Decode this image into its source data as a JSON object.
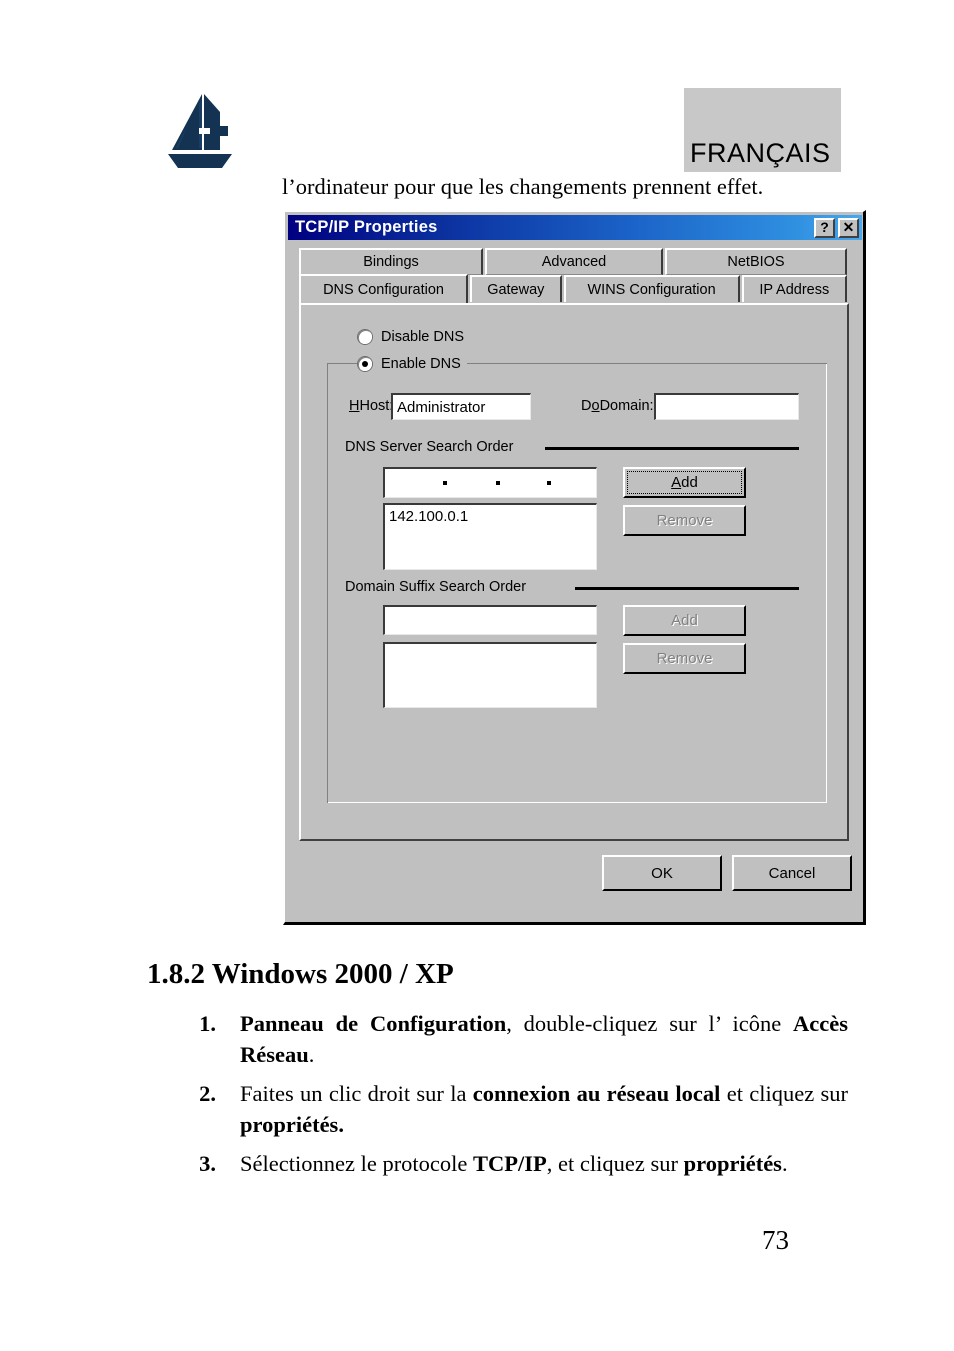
{
  "header": {
    "logo_alt": "Atlantis sailboat A logo",
    "language_label": "FRANÇAIS"
  },
  "intro_line": "l’ordinateur pour que les changements prennent effet.",
  "dialog": {
    "title": "TCP/IP Properties",
    "titlebar_buttons": [
      {
        "name": "help-button",
        "glyph": "?"
      },
      {
        "name": "close-button",
        "glyph": "✕"
      }
    ],
    "tabs_row1": [
      {
        "label": "Bindings",
        "active": false
      },
      {
        "label": "Advanced",
        "active": false
      },
      {
        "label": "NetBIOS",
        "active": false
      }
    ],
    "tabs_row2": [
      {
        "label": "DNS Configuration",
        "active": true
      },
      {
        "label": "Gateway",
        "active": false
      },
      {
        "label": "WINS Configuration",
        "active": false
      },
      {
        "label": "IP Address",
        "active": false
      }
    ],
    "radios": [
      {
        "label": "Disable DNS",
        "checked": false
      },
      {
        "label": "Enable DNS",
        "checked": true
      }
    ],
    "host": {
      "label": "Host:",
      "value": "Administrator"
    },
    "domain": {
      "label": "Domain:",
      "value": ""
    },
    "dns_group": {
      "legend": "DNS Server Search Order",
      "ip_entry_value": "",
      "ip_entry_separators": ". . .",
      "list_items": [
        "142.100.0.1"
      ],
      "add_label": "Add",
      "remove_label": "Remove",
      "add_enabled": true,
      "remove_enabled": false
    },
    "suffix_group": {
      "legend": "Domain Suffix Search Order",
      "entry_value": "",
      "list_items": [],
      "add_label": "Add",
      "remove_label": "Remove",
      "add_enabled": false,
      "remove_enabled": false
    },
    "footer_buttons": {
      "ok_label": "OK",
      "cancel_label": "Cancel"
    }
  },
  "section": {
    "heading": "1.8.2 Windows 2000 / XP",
    "steps": [
      {
        "num": "1.",
        "html": "<b>Panneau de Configuration</b>, double-cliquez sur l’ icône <b>Accès Réseau</b>."
      },
      {
        "num": "2.",
        "html": "Faites un clic droit sur la <b>connexion au réseau local</b> et cliquez sur <b>propriétés.</b>"
      },
      {
        "num": "3.",
        "html": "Sélectionnez le protocole <b>TCP/IP</b>, et cliquez sur <b>propriétés</b>."
      }
    ]
  },
  "page_number": "73",
  "colors": {
    "dialog_face": "#c0c0c0",
    "titlebar_start": "#000080",
    "titlebar_end": "#4aa8ee",
    "lang_box": "#c8c8c8",
    "logo_navy": "#143352"
  }
}
